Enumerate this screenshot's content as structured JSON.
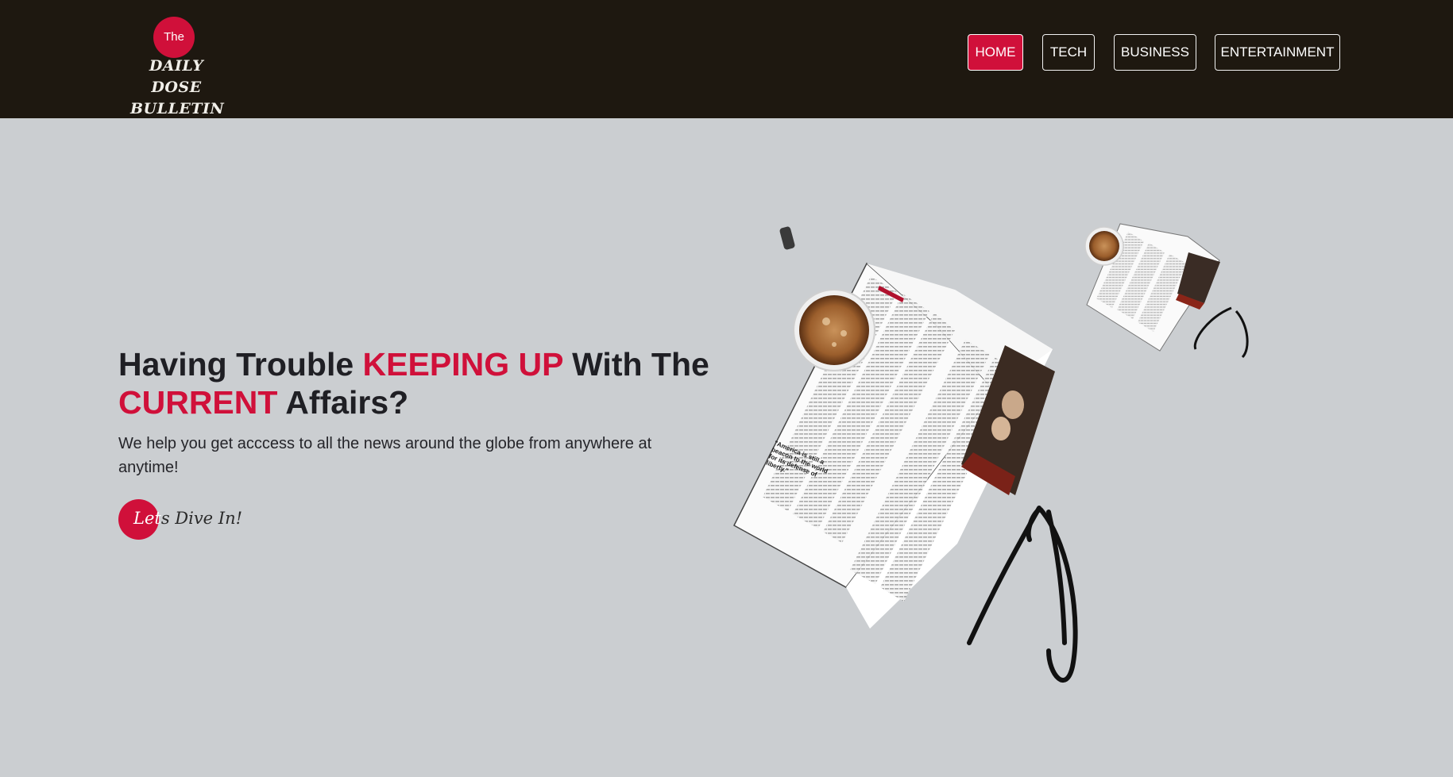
{
  "header": {
    "logo": {
      "badge": "The",
      "line1": "DAILY DOSE",
      "line2": "BULLETIN"
    },
    "nav": [
      {
        "label": "HOME",
        "active": true
      },
      {
        "label": "TECH",
        "active": false
      },
      {
        "label": "BUSINESS",
        "active": false
      },
      {
        "label": "ENTERTAINMENT",
        "active": false
      }
    ]
  },
  "hero": {
    "title_part1": "Having Trouble ",
    "title_accent1": "KEEPING UP",
    "title_part2": " With The",
    "title_accent2": "CURRENT",
    "title_part3": " Affairs?",
    "subtitle": "We help you get acccess to all the news around the globe from anywhere at anytime!",
    "cta_first": "Let",
    "cta_rest": "s Dive In!",
    "pullquote": "\"America is still a beacon to the world for its defense of liberty.\""
  },
  "colors": {
    "header_bg": "#1e1810",
    "page_bg": "#cbced1",
    "accent": "#d0103a",
    "text": "#1f1f24"
  }
}
